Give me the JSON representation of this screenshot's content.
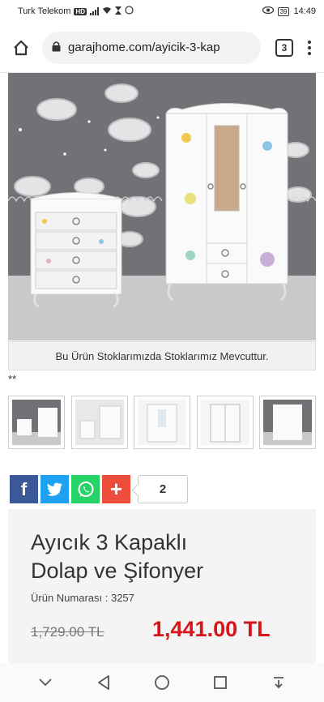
{
  "status_bar": {
    "carrier": "Turk Telekom",
    "network_badge": "HD",
    "battery": "39",
    "time": "14:49"
  },
  "browser": {
    "url": "garajhome.com/ayicik-3-kap",
    "tab_count": "3"
  },
  "product": {
    "image_caption": "Bu Ürün Stoklarımızda Stoklarımız Mevcuttur.",
    "stars_text": "**",
    "thumbnail_count": 5,
    "title_line1": "Ayıcık 3 Kapaklı",
    "title_line2": "Dolap ve Şifonyer",
    "sku_text": "Ürün Numarası : 3257",
    "old_price": "1,729.00 TL",
    "new_price": "1,441.00 TL"
  },
  "share": {
    "facebook_glyph": "f",
    "plus_glyph": "+",
    "count": "2"
  },
  "colors": {
    "facebook": "#3b5998",
    "twitter": "#1da1f2",
    "whatsapp": "#25d366",
    "plus": "#ef4d3c",
    "price_red": "#d8141b"
  },
  "nav": {
    "icons": [
      "chevron-down-icon",
      "back-icon",
      "home-circle-icon",
      "recents-icon",
      "download-icon"
    ]
  }
}
